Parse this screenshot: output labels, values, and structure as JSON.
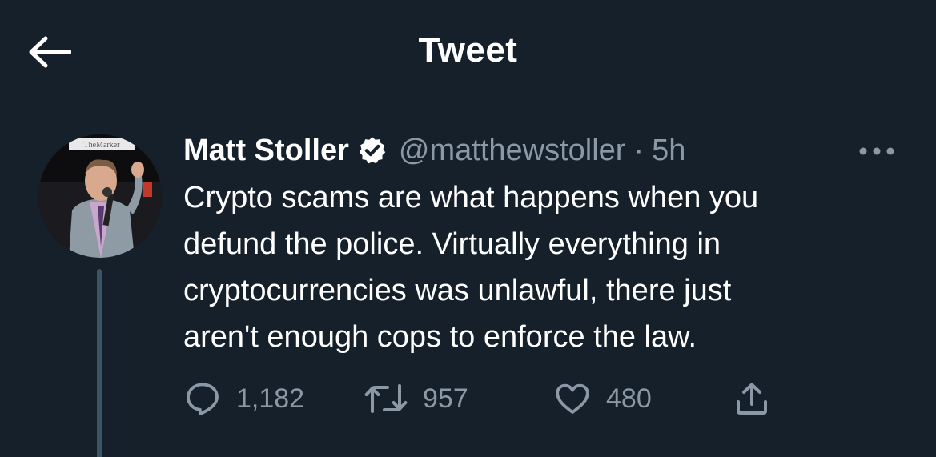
{
  "header": {
    "title": "Tweet",
    "back_icon": "arrow-left-icon"
  },
  "tweet": {
    "author": {
      "display_name": "Matt Stoller",
      "verified": true,
      "handle": "@matthewstoller",
      "avatar_badge_text": "TheMarker"
    },
    "separator": "·",
    "time": "5h",
    "text": "Crypto scams are what happens when you\ndefund the police. Virtually everything in\ncryptocurrencies was unlawful, there just\naren't enough cops to enforce the law.",
    "actions": {
      "reply": {
        "icon": "reply-icon",
        "count": "1,182"
      },
      "retweet": {
        "icon": "retweet-icon",
        "count": "957"
      },
      "like": {
        "icon": "heart-icon",
        "count": "480"
      },
      "share": {
        "icon": "share-icon"
      }
    }
  },
  "colors": {
    "background": "#15202b",
    "text_primary": "#ffffff",
    "text_secondary": "#8b98a5",
    "thread_line": "#3d5466"
  }
}
